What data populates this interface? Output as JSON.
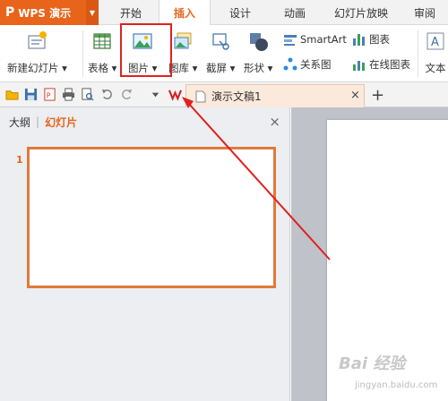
{
  "app": {
    "name": "WPS 演示",
    "logo_mark": "P"
  },
  "tabs": [
    {
      "label": "开始"
    },
    {
      "label": "插入"
    },
    {
      "label": "设计"
    },
    {
      "label": "动画"
    },
    {
      "label": "幻灯片放映"
    },
    {
      "label": "审阅"
    }
  ],
  "active_tab": "插入",
  "ribbon": {
    "new_slide": "新建幻灯片 ▾",
    "table": "表格 ▾",
    "picture": "图片 ▾",
    "gallery": "图库 ▾",
    "screenshot": "截屏 ▾",
    "shapes": "形状 ▾",
    "smartart": "SmartArt",
    "chart": "图表",
    "relation": "关系图",
    "online_chart": "在线图表",
    "textbox": "文本"
  },
  "document": {
    "tab_title": "演示文稿1",
    "close": "×",
    "add": "+"
  },
  "left_pane": {
    "outline_tab": "大纲",
    "divider": "|",
    "slides_tab": "幻灯片",
    "close": "×",
    "slide_number": "1"
  },
  "watermark": {
    "text": "Bai 经验",
    "sub": "jingyan.baidu.com"
  },
  "colors": {
    "accent": "#e8641b",
    "highlight": "#e02020"
  }
}
